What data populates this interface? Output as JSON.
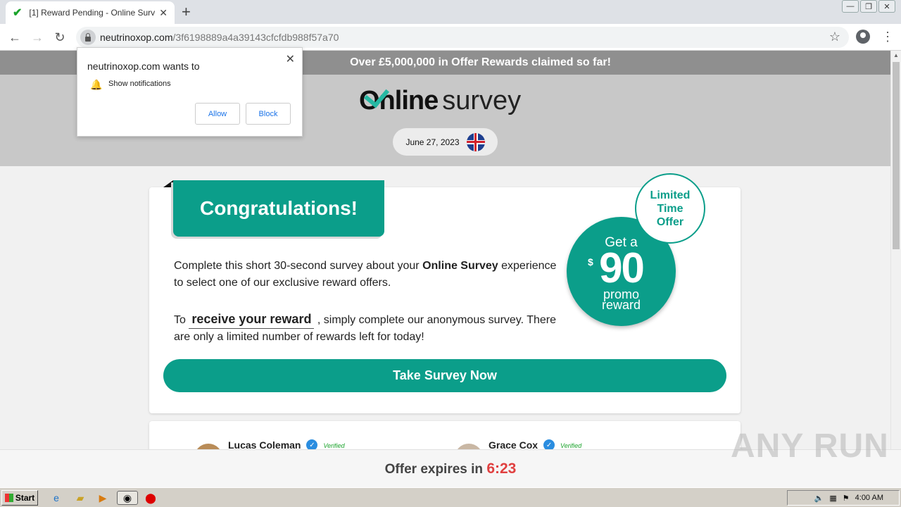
{
  "browser": {
    "tab_title": "[1] Reward Pending - Online Survey",
    "url_host": "neutrinoxop.com",
    "url_path": "/3f6198889a4a39143cfcfdb988f57a70"
  },
  "notification": {
    "title": "neutrinoxop.com wants to",
    "message": "Show notifications",
    "allow_label": "Allow",
    "block_label": "Block"
  },
  "page": {
    "promo_banner": "Over £5,000,000 in Offer Rewards claimed so far!",
    "logo_online": "Online",
    "logo_survey": "survey",
    "date": "June 27, 2023",
    "congrats": "Congratulations!",
    "para1_a": "Complete this short 30-second survey about your ",
    "para1_brand": "Online Survey",
    "para1_b": " experience to select one of our exclusive reward offers.",
    "para2_a": "To ",
    "para2_highlight": "receive your reward",
    "para2_b": " , simply complete our anonymous survey. There are only a limited number of rewards left for today!",
    "cta_label": "Take Survey Now",
    "badge_get": "Get a",
    "badge_currency": "$",
    "badge_amount": "90",
    "badge_promo_line1": "promo",
    "badge_promo_line2": "reward",
    "limited_line1": "Limited",
    "limited_line2": "Time",
    "limited_line3": "Offer",
    "reviews": [
      {
        "name": "Lucas Coleman",
        "verified": "Verified"
      },
      {
        "name": "Grace Cox",
        "verified": "Verified"
      }
    ],
    "expires_label": "Offer expires in ",
    "expires_timer": "6:23"
  },
  "watermark": "ANY RUN",
  "taskbar": {
    "start_label": "Start",
    "clock": "4:00 AM"
  },
  "colors": {
    "accent": "#0b9e8a",
    "timer": "#e04040"
  }
}
